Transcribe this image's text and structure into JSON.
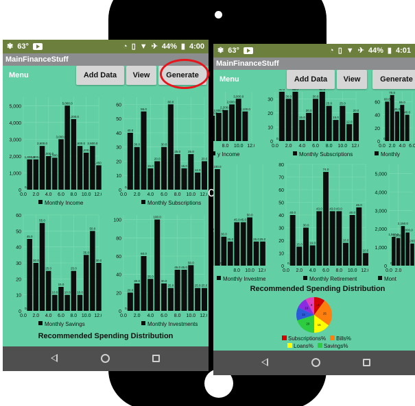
{
  "status": {
    "temp_left": "63°",
    "battery_left": "44%",
    "time_left": "4:00",
    "temp_right": "63°",
    "battery_right": "44%",
    "time_right": "4:01"
  },
  "app": {
    "title": "MainFinanceStuff"
  },
  "toolbar": {
    "menu_label": "Menu",
    "add_data_label": "Add Data",
    "view_label": "View",
    "generate_label": "Generate"
  },
  "section": {
    "recommended_title": "Recommended Spending Distribution"
  },
  "pie_legend": [
    {
      "label": "Subscriptions%",
      "color": "#d40000"
    },
    {
      "label": "Bills%",
      "color": "#ff7f0e"
    },
    {
      "label": "Loans%",
      "color": "#ffff00"
    },
    {
      "label": "Savings%",
      "color": "#2ecc40"
    }
  ],
  "pie_labels": [
    "10",
    "25",
    "15",
    "20",
    "12",
    "10",
    "8"
  ],
  "colors": {
    "screen_bg": "#62d0a4",
    "status_bar": "#6c7f3c",
    "title_bar": "#8b8d8f",
    "highlight": "#e8141b"
  },
  "chart_data": [
    {
      "id": "income",
      "type": "bar",
      "legend": "Monthly Income",
      "x": [
        1,
        2,
        3,
        4,
        5,
        6,
        7,
        8,
        9,
        10,
        11,
        12
      ],
      "values": [
        1800,
        1800,
        2600,
        2000,
        1900,
        3000,
        5000,
        4200,
        2600,
        2200,
        2600,
        1450
      ],
      "data_labels": [
        "1,800.0",
        "1,800.0",
        "2,600.0",
        "2,000.0",
        "1,900.0",
        "3,000.0",
        "5,000.0",
        "4,200.0",
        "2,600.0",
        "2,200.0",
        "2,600.0",
        "1,450.0"
      ],
      "ylim": [
        0,
        5500
      ],
      "yticks": [
        "0",
        "1,000",
        "2,000",
        "3,000",
        "4,000",
        "5,000"
      ],
      "xticks": [
        "0.0",
        "2.0",
        "4.0",
        "6.0",
        "8.0",
        "10.0",
        "12.0"
      ],
      "xlim": [
        0,
        12
      ]
    },
    {
      "id": "subscriptions",
      "type": "bar",
      "legend": "Monthly Subscriptions",
      "x": [
        1,
        2,
        3,
        4,
        5,
        6,
        7,
        8,
        9,
        10,
        11,
        12
      ],
      "values": [
        40,
        30,
        55,
        15,
        20,
        30,
        60,
        25,
        15,
        25,
        12,
        20
      ],
      "data_labels": [
        "40.0",
        "30.0",
        "55.0",
        "15.0",
        "20.0",
        "30.0",
        "60.0",
        "25.0",
        "15.0",
        "25.0",
        "12.0",
        "20.0"
      ],
      "ylim": [
        0,
        65
      ],
      "yticks": [
        "0",
        "10",
        "20",
        "30",
        "40",
        "50",
        "60"
      ],
      "xticks": [
        "0.0",
        "2.0",
        "4.0",
        "6.0",
        "8.0",
        "10.0",
        "12.0"
      ],
      "xlim": [
        0,
        12
      ]
    },
    {
      "id": "savings",
      "type": "bar",
      "legend": "Monthly Savings",
      "x": [
        1,
        2,
        3,
        4,
        5,
        6,
        7,
        8,
        9,
        10,
        11,
        12
      ],
      "values": [
        45,
        30,
        55,
        25,
        10,
        15,
        10,
        25,
        10,
        35,
        50,
        30
      ],
      "data_labels": [
        "45.0",
        "30.0",
        "55.0",
        "25.0",
        "10.0",
        "15.0",
        "10.0",
        "25.0",
        "10.0",
        "35.0",
        "50.0",
        "30.0"
      ],
      "ylim": [
        0,
        60
      ],
      "yticks": [
        "0",
        "10",
        "20",
        "30",
        "40",
        "50",
        "60"
      ],
      "xticks": [
        "0.0",
        "2.0",
        "4.0",
        "6.0",
        "8.0",
        "10.0",
        "12.0"
      ],
      "xlim": [
        0,
        12
      ]
    },
    {
      "id": "investments",
      "type": "bar",
      "legend": "Monthly Investments",
      "x": [
        1,
        2,
        3,
        4,
        5,
        6,
        7,
        8,
        9,
        10,
        11,
        12
      ],
      "values": [
        20,
        30,
        60,
        35,
        100,
        30,
        25,
        45,
        45,
        50,
        25,
        25
      ],
      "data_labels": [
        "20.0",
        "30.0",
        "60.0",
        "35.0",
        "100.0",
        "30.0",
        "25.0",
        "45.0",
        "45.0",
        "50.0",
        "25.0",
        "25.0"
      ],
      "ylim": [
        0,
        105
      ],
      "yticks": [
        "0",
        "20",
        "40",
        "60",
        "80",
        "100"
      ],
      "xticks": [
        "0.0",
        "2.0",
        "4.0",
        "6.0",
        "8.0",
        "10.0",
        "12.0"
      ],
      "xlim": [
        0,
        12
      ]
    },
    {
      "id": "right-income-crop",
      "type": "bar",
      "legend": "y Income",
      "x": [
        6,
        7,
        8,
        9,
        10,
        11
      ],
      "values": [
        1800,
        2000,
        2200,
        2600,
        3000,
        2100
      ],
      "data_labels": [
        "1,800.0",
        "2,000.0",
        "2,200.0",
        "2,600.0",
        "3,000.0",
        "2,100.0"
      ],
      "ylim": [
        0,
        3500
      ],
      "yticks": [],
      "xticks": [
        "8.0",
        "10.0",
        "12.0"
      ],
      "xlim": [
        6.6,
        12
      ]
    },
    {
      "id": "right-subscriptions-crop",
      "type": "bar",
      "legend": "Monthly Subscriptions",
      "x": [
        1,
        2,
        3,
        4,
        5,
        6,
        7,
        8,
        9,
        10,
        11,
        12
      ],
      "values": [
        40,
        30,
        55,
        15,
        20,
        30,
        60,
        25,
        15,
        25,
        12,
        20
      ],
      "data_labels": [
        "40.0",
        "30.0",
        "55.0",
        "15.0",
        "20.0",
        "30.0",
        "60.0",
        "25.0",
        "15.0",
        "25.0",
        "12.0",
        "20.0"
      ],
      "ylim": [
        0,
        35
      ],
      "yticks": [
        "0",
        "10",
        "20",
        "30"
      ],
      "xticks": [
        "0.0",
        "2.0",
        "4.0",
        "6.0",
        "8.0",
        "10.0",
        "12.0"
      ],
      "xlim": [
        0,
        12
      ]
    },
    {
      "id": "right-savings-crop",
      "type": "bar",
      "legend": "Monthly",
      "x": [
        1,
        2,
        3,
        4,
        5
      ],
      "values": [
        60,
        70,
        45,
        55,
        40
      ],
      "data_labels": [
        "60.0",
        "70.0",
        "45.0",
        "55.0",
        "40.0"
      ],
      "ylim": [
        0,
        75
      ],
      "yticks": [
        "0",
        "20",
        "40",
        "60"
      ],
      "xticks": [
        "0.0",
        "2.0",
        "4.0",
        "6.0"
      ],
      "xlim": [
        0,
        6
      ]
    },
    {
      "id": "right-investments-crop",
      "type": "bar",
      "legend": "Monthly Investments",
      "x": [
        1,
        2,
        3,
        4,
        5,
        6,
        7,
        8,
        9,
        10,
        11,
        12
      ],
      "values": [
        20,
        30,
        60,
        35,
        100,
        30,
        25,
        45,
        45,
        50,
        25,
        25
      ],
      "data_labels": [
        "20.0",
        "30.0",
        "60.0",
        "35.0",
        "100.0",
        "30.0",
        "25.0",
        "45.0",
        "45.0",
        "50.0",
        "25.0",
        "25.0"
      ],
      "ylim": [
        0,
        105
      ],
      "yticks": [],
      "xticks": [
        "8.0",
        "10.0",
        "12.0"
      ],
      "xlim": [
        4.8,
        12
      ]
    },
    {
      "id": "retirement",
      "type": "bar",
      "legend": "Monthly Retirement",
      "x": [
        1,
        2,
        3,
        4,
        5,
        6,
        7,
        8,
        9,
        10,
        11,
        12
      ],
      "values": [
        40,
        15,
        30,
        16,
        43,
        74,
        43,
        43,
        18,
        40,
        46,
        10
      ],
      "data_labels": [
        "40.0",
        "15.0",
        "30.0",
        "16.0",
        "43.0",
        "74.0",
        "43.0",
        "43.0",
        "18.0",
        "40.0",
        "46.0",
        "10.0"
      ],
      "ylim": [
        0,
        80
      ],
      "yticks": [
        "0",
        "10",
        "20",
        "30",
        "40",
        "50",
        "60",
        "70",
        "80"
      ],
      "xticks": [
        "0.0",
        "2.0",
        "4.0",
        "6.0",
        "8.0",
        "10.0",
        "12.0"
      ],
      "xlim": [
        0,
        12
      ]
    },
    {
      "id": "right-income-bottom-crop",
      "type": "bar",
      "legend": "Mont",
      "x": [
        1,
        2,
        3,
        4,
        5
      ],
      "values": [
        1560,
        1500,
        2150,
        1800,
        1200
      ],
      "data_labels": [
        "1,560.0",
        "1,500.0",
        "2,150.0",
        "1,800.0",
        "1,200.0"
      ],
      "ylim": [
        0,
        5500
      ],
      "yticks": [
        "0",
        "1,000",
        "2,000",
        "3,000",
        "4,000",
        "5,000"
      ],
      "xticks": [
        "0.0",
        "2.0"
      ],
      "xlim": [
        0,
        5
      ]
    }
  ]
}
